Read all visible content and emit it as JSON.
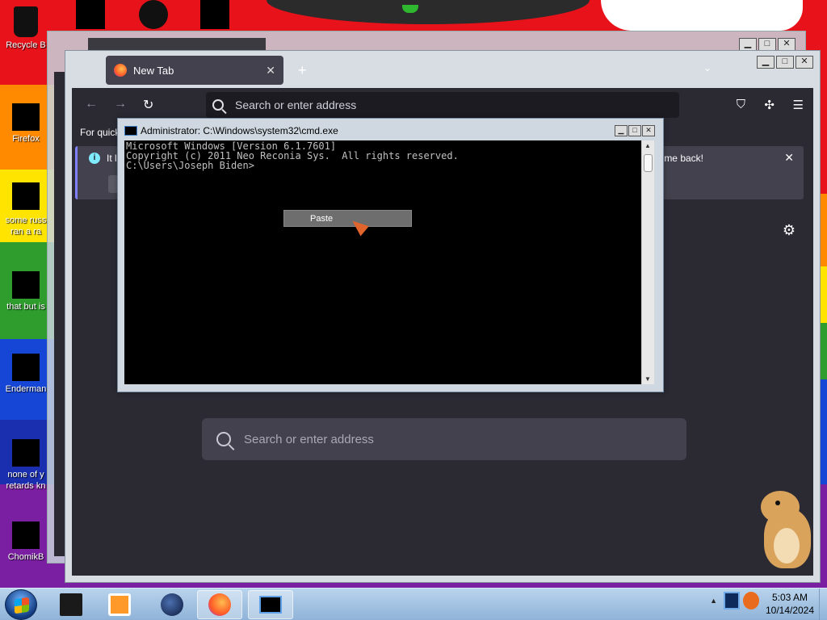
{
  "desktop": {
    "icons": [
      {
        "label": "Recycle B",
        "icon": "recycle-bin-icon"
      },
      {
        "label": "Firefox",
        "icon": "firefox-icon"
      },
      {
        "label": "some russ ran a ra",
        "icon": "shortcut-icon"
      },
      {
        "label": "that but is",
        "icon": "folder-icon"
      },
      {
        "label": "Enderman",
        "icon": "shortcut-icon"
      },
      {
        "label": "none of y retards kn",
        "icon": "shortcut-icon"
      },
      {
        "label": "ChomikB",
        "icon": "hamster-icon"
      }
    ]
  },
  "firefox": {
    "tab_title": "New Tab",
    "new_tab_symbol": "+",
    "address_placeholder": "Search or enter address",
    "bookmarks_text": "For quick",
    "notice_left": "It l",
    "notice_right": "me back!",
    "notice_close": "✕",
    "page_search_placeholder": "Search or enter address",
    "colors": {
      "toolbar": "#2b2a33",
      "tab": "#42414d",
      "text": "#fbfbfe",
      "accent": "#80ebff"
    }
  },
  "cmd": {
    "title": "Administrator: C:\\Windows\\system32\\cmd.exe",
    "lines": [
      "Microsoft Windows [Version 6.1.7601]",
      "Copyright (c) 2011 Neo Reconia Sys.  All rights reserved.",
      "",
      "C:\\Users\\Joseph Biden>"
    ],
    "context_menu_item": "Paste"
  },
  "window_buttons": {
    "minimize": "▁",
    "maximize": "□",
    "close": "✕"
  },
  "taskbar": {
    "items": [
      {
        "icon": "black-box-icon",
        "active": false
      },
      {
        "icon": "media-player-icon",
        "active": false
      },
      {
        "icon": "globe-icon",
        "active": false
      },
      {
        "icon": "firefox-icon",
        "active": true
      },
      {
        "icon": "cmd-icon",
        "active": true
      }
    ],
    "tray_arrow": "▲",
    "time": "5:03 AM",
    "date": "10/14/2024"
  }
}
